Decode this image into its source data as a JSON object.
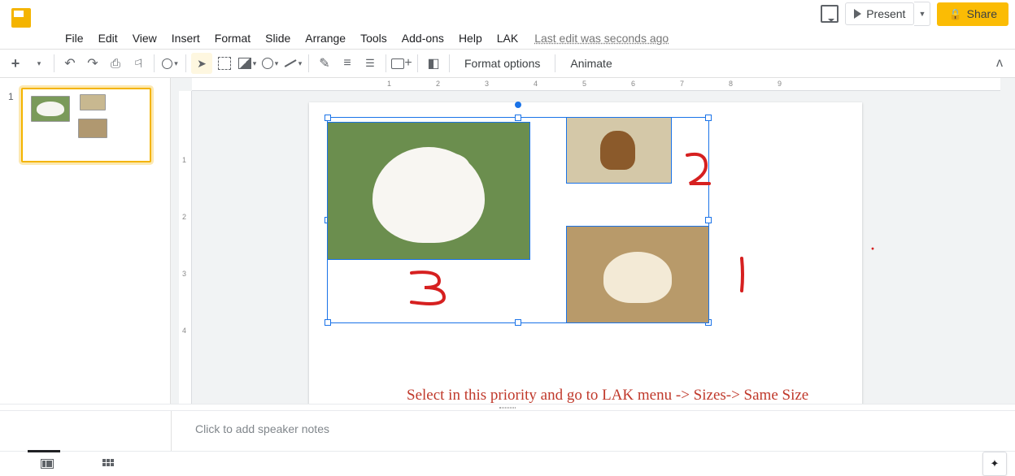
{
  "header": {
    "last_edit": "Last edit was seconds ago",
    "present": "Present",
    "share": "Share"
  },
  "menu": {
    "items": [
      "File",
      "Edit",
      "View",
      "Insert",
      "Format",
      "Slide",
      "Arrange",
      "Tools",
      "Add-ons",
      "Help",
      "LAK"
    ]
  },
  "toolbar": {
    "format_options": "Format options",
    "animate": "Animate"
  },
  "ruler": {
    "h": [
      "1",
      "2",
      "3",
      "4",
      "5",
      "6",
      "7",
      "8",
      "9"
    ],
    "v": [
      "1",
      "2",
      "3",
      "4"
    ]
  },
  "filmstrip": {
    "slide_number": "1"
  },
  "annotations": {
    "label1": "1",
    "label2": "2",
    "label3": "3",
    "instruction": "Select in this priority and go to LAK menu -> Sizes-> Same Size"
  },
  "notes": {
    "placeholder": "Click to add speaker notes"
  }
}
